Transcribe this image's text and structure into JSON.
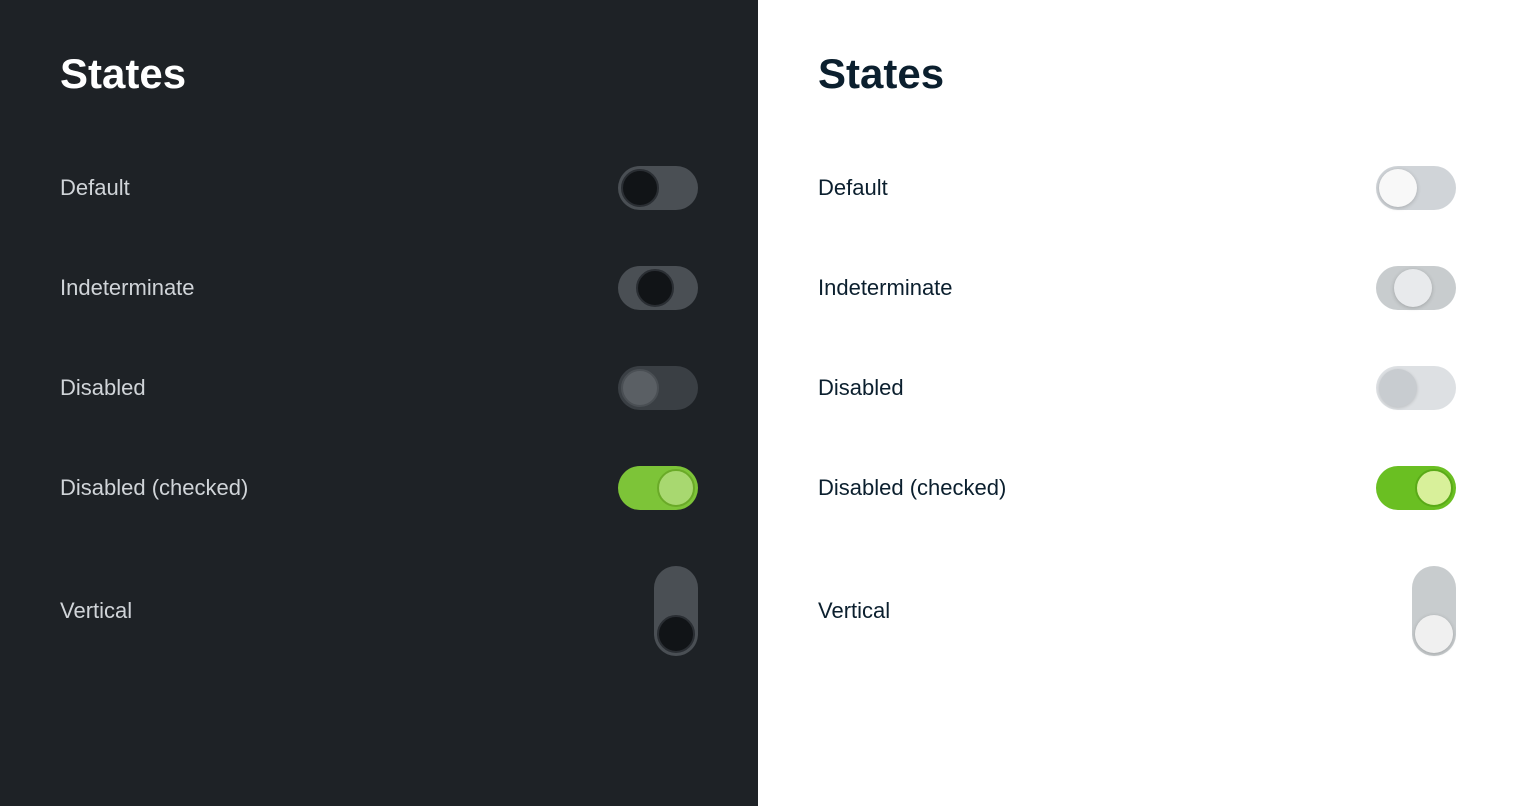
{
  "dark_panel": {
    "title": "States",
    "rows": [
      {
        "label": "Default",
        "state": "default"
      },
      {
        "label": "Indeterminate",
        "state": "indeterminate"
      },
      {
        "label": "Disabled",
        "state": "disabled"
      },
      {
        "label": "Disabled (checked)",
        "state": "disabled-checked"
      },
      {
        "label": "Vertical",
        "state": "vertical"
      }
    ]
  },
  "light_panel": {
    "title": "States",
    "rows": [
      {
        "label": "Default",
        "state": "default"
      },
      {
        "label": "Indeterminate",
        "state": "indeterminate"
      },
      {
        "label": "Disabled",
        "state": "disabled"
      },
      {
        "label": "Disabled (checked)",
        "state": "disabled-checked"
      },
      {
        "label": "Vertical",
        "state": "vertical"
      }
    ]
  }
}
